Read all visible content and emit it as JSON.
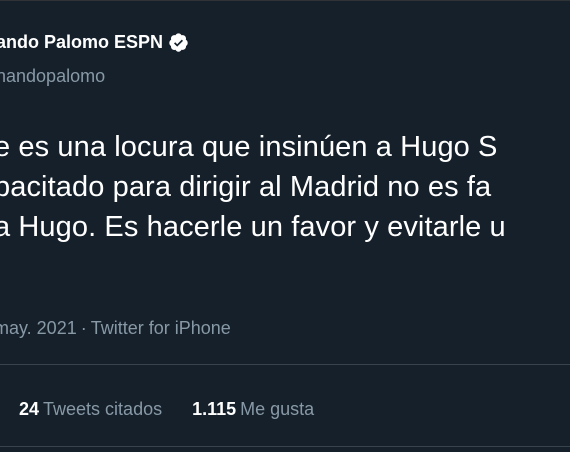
{
  "author": {
    "display_name": "ando Palomo ESPN",
    "handle": "nandopalomo",
    "verified": true,
    "verified_icon": "verified-badge-icon"
  },
  "tweet": {
    "lines": [
      "e es una locura que insinúen a Hugo S",
      "pacitado para dirigir al Madrid no es fa",
      "a Hugo. Es hacerle un favor y evitarle u"
    ]
  },
  "meta": {
    "date": "may. 2021",
    "separator": "·",
    "source": "Twitter for iPhone"
  },
  "stats": {
    "quotes_count": "24",
    "quotes_label": "Tweets citados",
    "likes_count": "1.115",
    "likes_label": "Me gusta"
  },
  "colors": {
    "background": "#15202b",
    "text_primary": "#ffffff",
    "text_secondary": "#8899a6",
    "verified": "#ffffff"
  }
}
